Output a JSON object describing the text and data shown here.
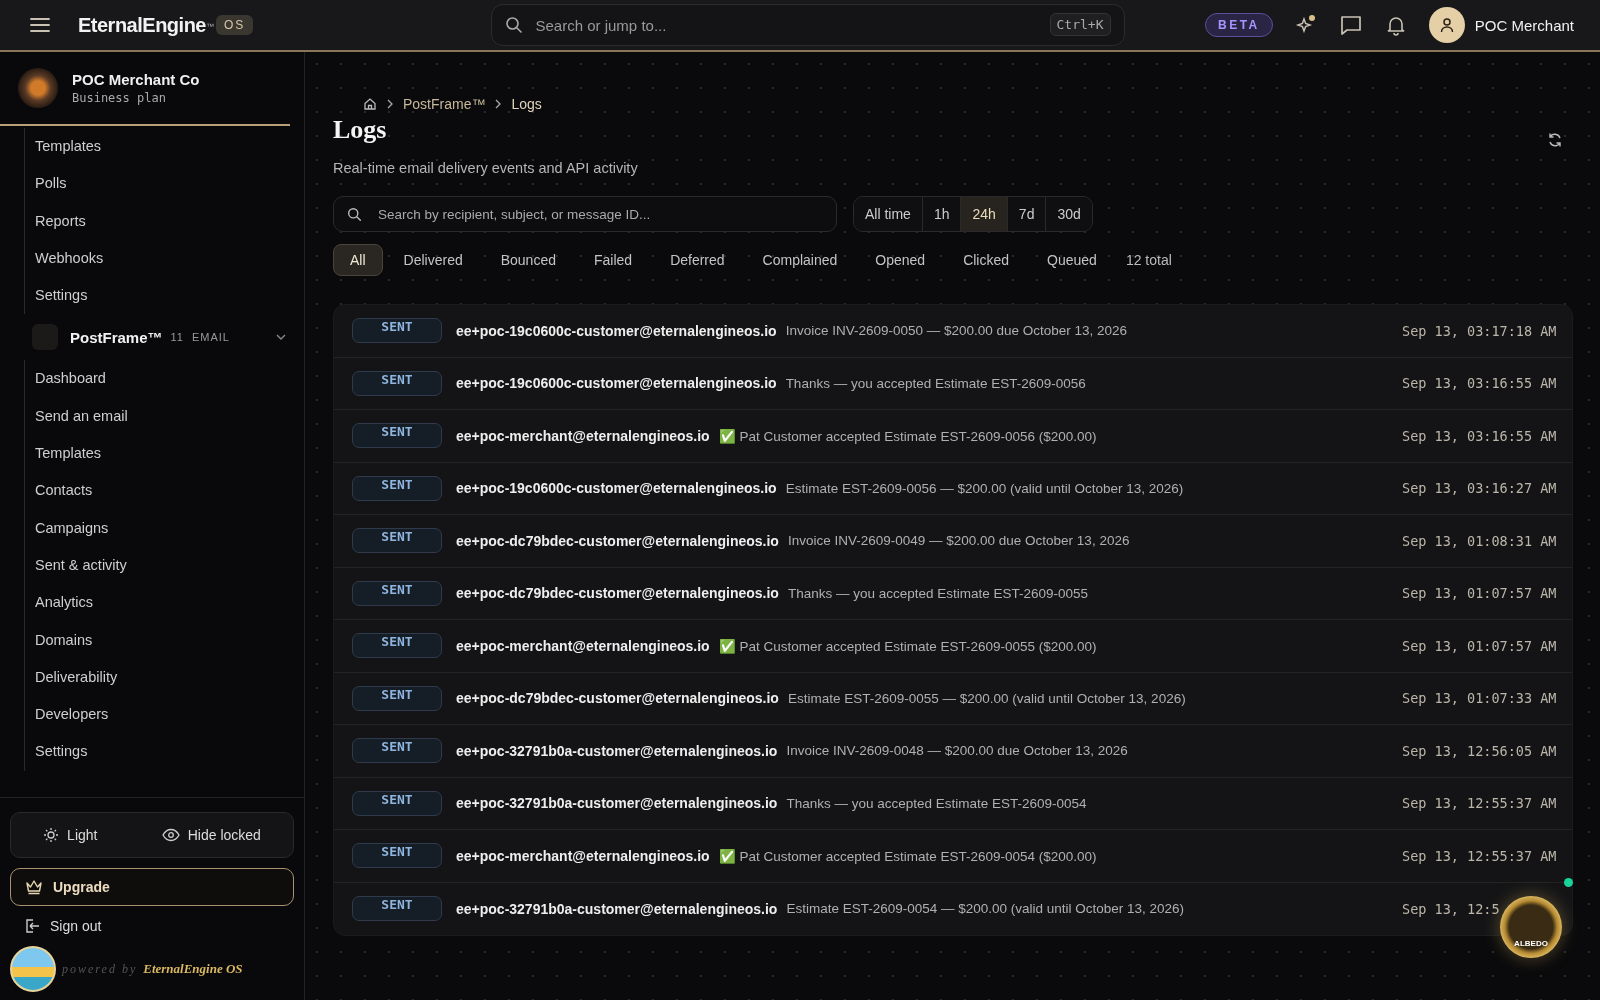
{
  "header": {
    "logo": "EternalEngine",
    "trademark": "™",
    "os_badge": "OS",
    "search_placeholder": "Search or jump to...",
    "shortcut": "Ctrl+K",
    "beta": "BETA",
    "user": "POC Merchant"
  },
  "sidebar": {
    "org_name": "POC Merchant Co",
    "org_plan": "Business plan",
    "nav_items": [
      {
        "label": "Templates"
      },
      {
        "label": "Polls"
      },
      {
        "label": "Reports"
      },
      {
        "label": "Webhooks"
      },
      {
        "label": "Settings"
      }
    ],
    "group": {
      "name": "PostFrame™",
      "count": "11",
      "tag": "EMAIL",
      "expanded": true,
      "items": [
        {
          "label": "Dashboard"
        },
        {
          "label": "Send an email"
        },
        {
          "label": "Templates"
        },
        {
          "label": "Contacts"
        },
        {
          "label": "Campaigns"
        },
        {
          "label": "Sent & activity"
        },
        {
          "label": "Analytics"
        },
        {
          "label": "Domains"
        },
        {
          "label": "Deliverability"
        },
        {
          "label": "Developers"
        },
        {
          "label": "Settings"
        }
      ]
    },
    "theme_button": "Light",
    "hide_locked_button": "Hide locked",
    "upgrade_button": "Upgrade",
    "sign_out": "Sign out",
    "powered_by": "powered by",
    "powered_brand": "EternalEngine OS"
  },
  "breadcrumb": [
    "PostFrame™",
    "Logs"
  ],
  "title": "Logs",
  "subtitle": "Real-time email delivery events and API activity",
  "search_placeholder": "Search by recipient, subject, or message ID...",
  "time_ranges": [
    {
      "label": "All time",
      "selected": false
    },
    {
      "label": "1h",
      "selected": false
    },
    {
      "label": "24h",
      "selected": true
    },
    {
      "label": "7d",
      "selected": false
    },
    {
      "label": "30d",
      "selected": false
    }
  ],
  "status_filters": [
    {
      "label": "All",
      "selected": true
    },
    {
      "label": "Delivered",
      "selected": false
    },
    {
      "label": "Bounced",
      "selected": false
    },
    {
      "label": "Failed",
      "selected": false
    },
    {
      "label": "Deferred",
      "selected": false
    },
    {
      "label": "Complained",
      "selected": false
    },
    {
      "label": "Opened",
      "selected": false
    },
    {
      "label": "Clicked",
      "selected": false
    },
    {
      "label": "Queued",
      "selected": false
    }
  ],
  "total": "12 total",
  "rows": [
    {
      "kind": "sent",
      "status": "SENT",
      "recipient": "ee+poc-19c0600c-customer@eternalengineos.io",
      "subject": "Invoice INV-2609-0050 — $200.00 due October 13, 2026",
      "time": "Sep 13, 03:17:18 AM"
    },
    {
      "kind": "sent",
      "status": "SENT",
      "recipient": "ee+poc-19c0600c-customer@eternalengineos.io",
      "subject": "Thanks — you accepted Estimate EST-2609-0056",
      "time": "Sep 13, 03:16:55 AM"
    },
    {
      "kind": "sent",
      "status": "SENT",
      "recipient": "ee+poc-merchant@eternalengineos.io",
      "subject": "✅ Pat Customer accepted Estimate EST-2609-0056 ($200.00)",
      "time": "Sep 13, 03:16:55 AM"
    },
    {
      "kind": "sent",
      "status": "SENT",
      "recipient": "ee+poc-19c0600c-customer@eternalengineos.io",
      "subject": "Estimate EST-2609-0056 — $200.00 (valid until October 13, 2026)",
      "time": "Sep 13, 03:16:27 AM"
    },
    {
      "kind": "sent",
      "status": "SENT",
      "recipient": "ee+poc-dc79bdec-customer@eternalengineos.io",
      "subject": "Invoice INV-2609-0049 — $200.00 due October 13, 2026",
      "time": "Sep 13, 01:08:31 AM"
    },
    {
      "kind": "sent",
      "status": "SENT",
      "recipient": "ee+poc-dc79bdec-customer@eternalengineos.io",
      "subject": "Thanks — you accepted Estimate EST-2609-0055",
      "time": "Sep 13, 01:07:57 AM"
    },
    {
      "kind": "sent",
      "status": "SENT",
      "recipient": "ee+poc-merchant@eternalengineos.io",
      "subject": "✅ Pat Customer accepted Estimate EST-2609-0055 ($200.00)",
      "time": "Sep 13, 01:07:57 AM"
    },
    {
      "kind": "sent",
      "status": "SENT",
      "recipient": "ee+poc-dc79bdec-customer@eternalengineos.io",
      "subject": "Estimate EST-2609-0055 — $200.00 (valid until October 13, 2026)",
      "time": "Sep 13, 01:07:33 AM"
    },
    {
      "kind": "sent",
      "status": "SENT",
      "recipient": "ee+poc-32791b0a-customer@eternalengineos.io",
      "subject": "Invoice INV-2609-0048 — $200.00 due October 13, 2026",
      "time": "Sep 13, 12:56:05 AM"
    },
    {
      "kind": "sent",
      "status": "SENT",
      "recipient": "ee+poc-32791b0a-customer@eternalengineos.io",
      "subject": "Thanks — you accepted Estimate EST-2609-0054",
      "time": "Sep 13, 12:55:37 AM"
    },
    {
      "kind": "sent",
      "status": "SENT",
      "recipient": "ee+poc-merchant@eternalengineos.io",
      "subject": "✅ Pat Customer accepted Estimate EST-2609-0054 ($200.00)",
      "time": "Sep 13, 12:55:37 AM"
    },
    {
      "kind": "sent",
      "status": "SENT",
      "recipient": "ee+poc-32791b0a-customer@eternalengineos.io",
      "subject": "Estimate EST-2609-0054 — $200.00 (valid until October 13, 2026)",
      "time": "Sep 13, 12:5"
    }
  ],
  "assistant_badge": "ALBEDO"
}
